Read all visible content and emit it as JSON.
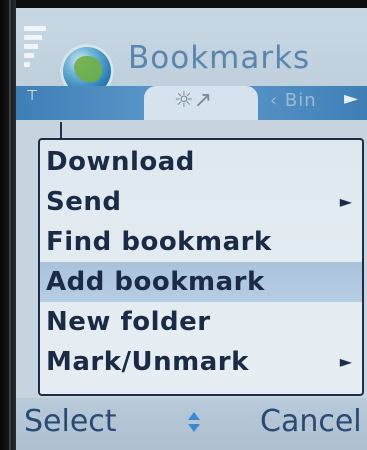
{
  "header": {
    "title": "Bookmarks"
  },
  "tabs": {
    "next_label": "‹ Bin"
  },
  "menu": {
    "items": [
      {
        "label": "Download",
        "has_submenu": false
      },
      {
        "label": "Send",
        "has_submenu": true
      },
      {
        "label": "Find bookmark",
        "has_submenu": false
      },
      {
        "label": "Add bookmark",
        "has_submenu": false
      },
      {
        "label": "New folder",
        "has_submenu": false
      },
      {
        "label": "Mark/Unmark",
        "has_submenu": true
      }
    ],
    "selected_index": 3
  },
  "softkeys": {
    "left": "Select",
    "right": "Cancel"
  },
  "icons": {
    "signal": "signal-strength-icon",
    "globe": "globe-icon",
    "antenna": "antenna-icon",
    "tab_active": "bookmarks-tab-icon",
    "submenu": "submenu-arrow-icon",
    "scroll": "scroll-updown-icon"
  },
  "colors": {
    "accent": "#3f7fb6",
    "menu_text": "#1b2b46",
    "selection": "#a9c2dc",
    "softkey_text": "#2a4a73"
  }
}
